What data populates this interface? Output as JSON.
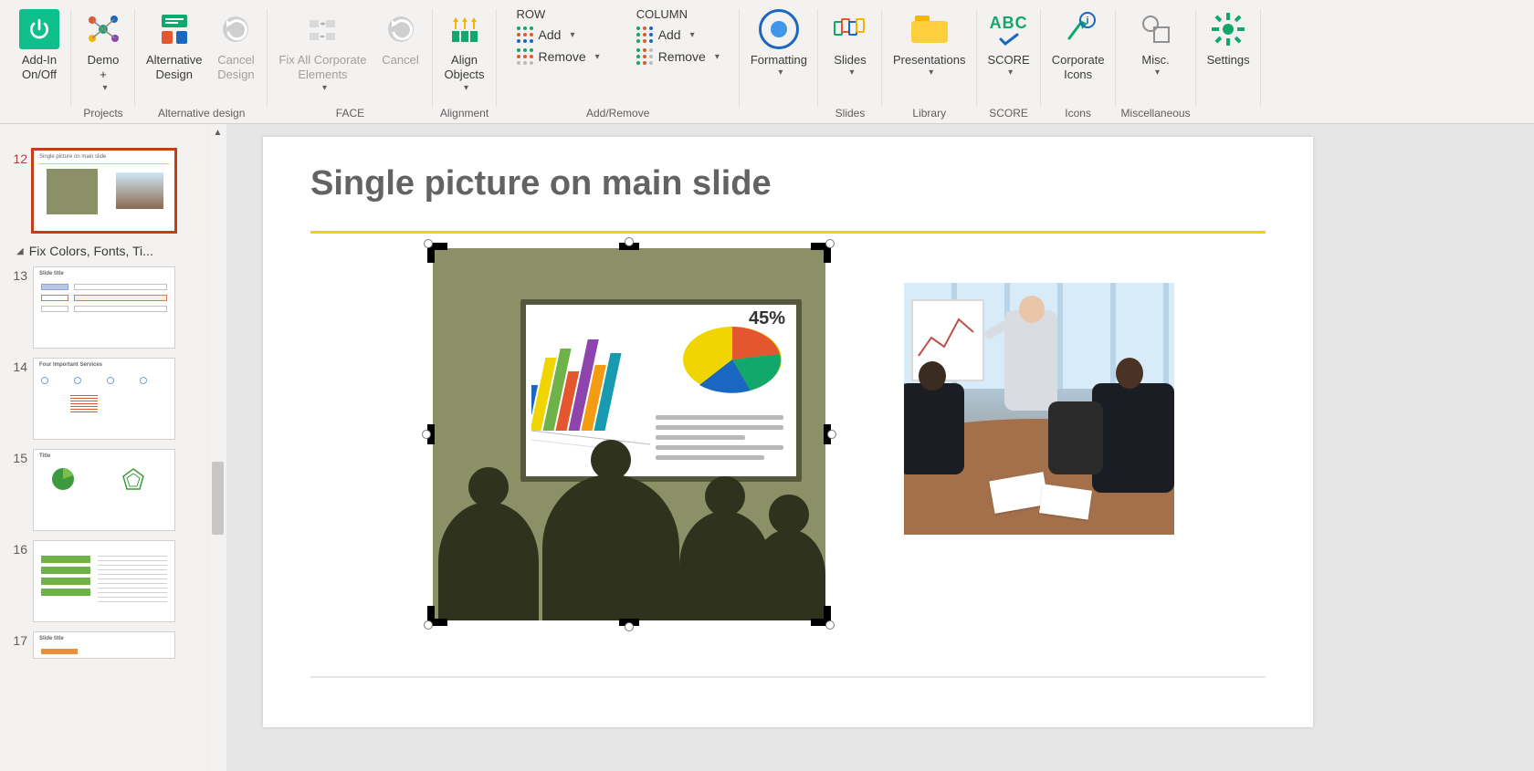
{
  "ribbon": {
    "addin": {
      "l1": "Add-In",
      "l2": "On/Off"
    },
    "demo": {
      "l1": "Demo",
      "l2": "+"
    },
    "alt": {
      "l1": "Alternative",
      "l2": "Design"
    },
    "cancel1": {
      "l1": "Cancel",
      "l2": "Design"
    },
    "fix": {
      "l1": "Fix All Corporate",
      "l2": "Elements"
    },
    "cancel2": {
      "l1": "Cancel"
    },
    "align": {
      "l1": "Align",
      "l2": "Objects"
    },
    "row": {
      "hdr": "ROW",
      "add": "Add",
      "remove": "Remove"
    },
    "col": {
      "hdr": "COLUMN",
      "add": "Add",
      "remove": "Remove"
    },
    "fmt": {
      "l1": "Formatting"
    },
    "slides": {
      "l1": "Slides"
    },
    "pres": {
      "l1": "Presentations"
    },
    "score": {
      "l1": "SCORE"
    },
    "corp": {
      "l1": "Corporate",
      "l2": "Icons"
    },
    "misc": {
      "l1": "Misc."
    },
    "settings": {
      "l1": "Settings"
    },
    "groups": {
      "projects": "Projects",
      "alternative": "Alternative design",
      "face": "FACE",
      "alignment": "Alignment",
      "addremove": "Add/Remove",
      "slides": "Slides",
      "library": "Library",
      "score": "SCORE",
      "icons": "Icons",
      "misc": "Miscellaneous"
    }
  },
  "thumbs": {
    "section": "Fix Colors, Fonts, Ti...",
    "n12": "12",
    "n13": "13",
    "n14": "14",
    "n15": "15",
    "n16": "16",
    "n17": "17",
    "t12": "Single picture on main slide",
    "t13": "Slide title",
    "t14": "Four Important Services",
    "t15": "Title",
    "t17": "Slide title"
  },
  "slide": {
    "title": "Single picture on main slide",
    "pct": "45%"
  }
}
